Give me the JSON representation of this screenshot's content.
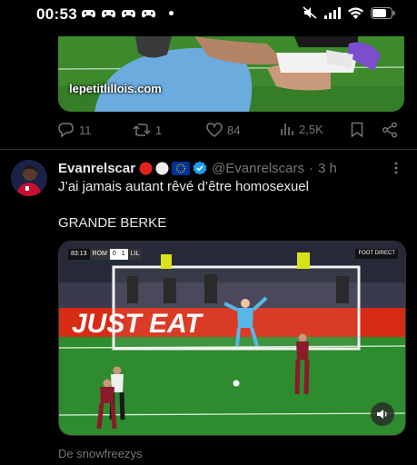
{
  "status_bar": {
    "time": "00:53",
    "notification_icons": [
      "game-controller-icon",
      "game-controller-icon",
      "game-controller-icon",
      "game-controller-icon"
    ],
    "system_icons": [
      "mute-icon",
      "signal-icon",
      "wifi-icon",
      "battery-icon"
    ]
  },
  "previous_tweet": {
    "media_watermark": "lepetitlillois.com",
    "actions": {
      "replies": "11",
      "reposts": "1",
      "likes": "84",
      "views": "2,5K"
    }
  },
  "tweet": {
    "display_name": "Evanrelscar",
    "flag_emojis": [
      "red-circle",
      "white-circle",
      "eu-flag"
    ],
    "verified": true,
    "handle": "@Evanrelscars",
    "separator": "·",
    "time_ago": "3 h",
    "text_line1": "J’ai jamais autant rêvé d’être homosexuel",
    "text_line2": "GRANDE BERKE",
    "video": {
      "scorebug_time": "83:13",
      "home_team": "ROM",
      "home_score": "0",
      "away_score": "1",
      "away_team": "LIL",
      "broadcaster": "FOOT DIRECT",
      "banner_text": "JUST EAT"
    },
    "attribution": "De snowfreezys"
  },
  "colors": {
    "background": "#000000",
    "text_primary": "#e7e9ea",
    "text_secondary": "#71767b",
    "verified_blue": "#1d9bf0",
    "pitch_green": "#2e8b2e"
  }
}
